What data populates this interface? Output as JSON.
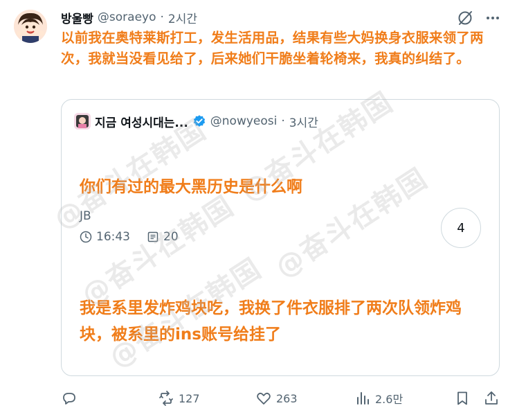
{
  "post": {
    "author_name": "방울빵",
    "author_handle": "@soraeyo",
    "separator": "·",
    "time": "2시간",
    "text": "以前我在奥特莱斯打工，发生活用品，结果有些大妈换身衣服来领了两次，我就当没看见给了，后来她们干脆坐着轮椅来，我真的纠结了。"
  },
  "quote": {
    "author_name": "지금 여성시대는...",
    "author_handle": "@nowyeosi",
    "separator": "·",
    "time": "3시간",
    "question": "你们有过的最大黑历史是什么啊",
    "author_tag": "JB",
    "clock_time": "16:43",
    "comment_count": "20",
    "reply_count_badge": "4",
    "reply": "我是系里发炸鸡块吃，我换了件衣服排了两次队领炸鸡块，被系里的ins账号给挂了"
  },
  "actions": {
    "retweets": "127",
    "likes": "263",
    "views": "2.6만"
  },
  "watermark": "@奋斗在韩国",
  "colors": {
    "overlay": "#f07d1a",
    "verified": "#1d9bf0",
    "muted": "#536471"
  }
}
